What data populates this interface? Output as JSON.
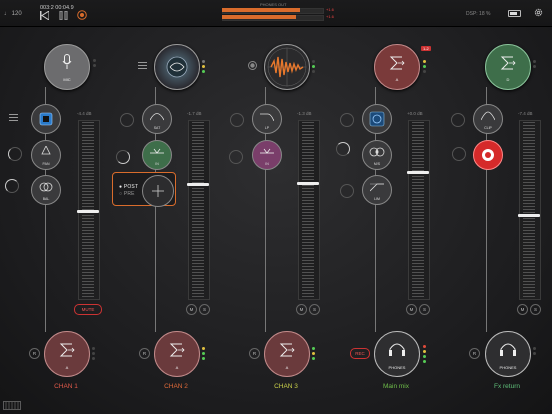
{
  "topbar": {
    "bpm": "♩ 120",
    "timecode": "003:2   00:04.9",
    "phones_label": "PHONES OUT",
    "clip_left": "+1.6",
    "clip_right": "+1.6",
    "dsp": "DSP: 18 %",
    "meter_level": 0.78
  },
  "channels": [
    {
      "name": "CHAN 1",
      "color": "#e0594a",
      "source": "MIC",
      "db": "-4.4 dB",
      "ins": [
        "",
        "PAN",
        "BAL"
      ],
      "output": "A",
      "mute": "MUTE",
      "r": "R"
    },
    {
      "name": "CHAN 2",
      "color": "#e06a3a",
      "source": "",
      "db": "-1.7 dB",
      "ins": [
        "SAT",
        "IN"
      ],
      "output": "A",
      "m": "M",
      "s": "S",
      "r": "R",
      "popup": {
        "post": "POST",
        "pre": "PRE"
      }
    },
    {
      "name": "CHAN 3",
      "color": "#c9d04a",
      "source": "",
      "db": "-1.3 dB",
      "ins": [
        "LP",
        "IN"
      ],
      "output": "A",
      "m": "M",
      "s": "S",
      "r": "R"
    },
    {
      "name": "Main mix",
      "color": "#6fbf4a",
      "source": "A",
      "db": "+0.0 dB",
      "ins": [
        "",
        "M/S",
        "LIM"
      ],
      "output": "PHONES",
      "m": "M",
      "s": "S",
      "rec": "REC",
      "badge": "1-2"
    },
    {
      "name": "Fx return",
      "color": "#5fbf7a",
      "source": "D",
      "db": "-7.4 dB",
      "ins": [
        "CLIP",
        ""
      ],
      "output": "PHONES",
      "m": "M",
      "s": "S",
      "r": "R"
    }
  ],
  "faders": [
    0.62,
    0.51,
    0.5,
    0.36,
    0.46
  ],
  "colors": {
    "orange": "#d96c2c",
    "red_src": "#7a3a3a",
    "green_src": "#3e6e4a"
  }
}
